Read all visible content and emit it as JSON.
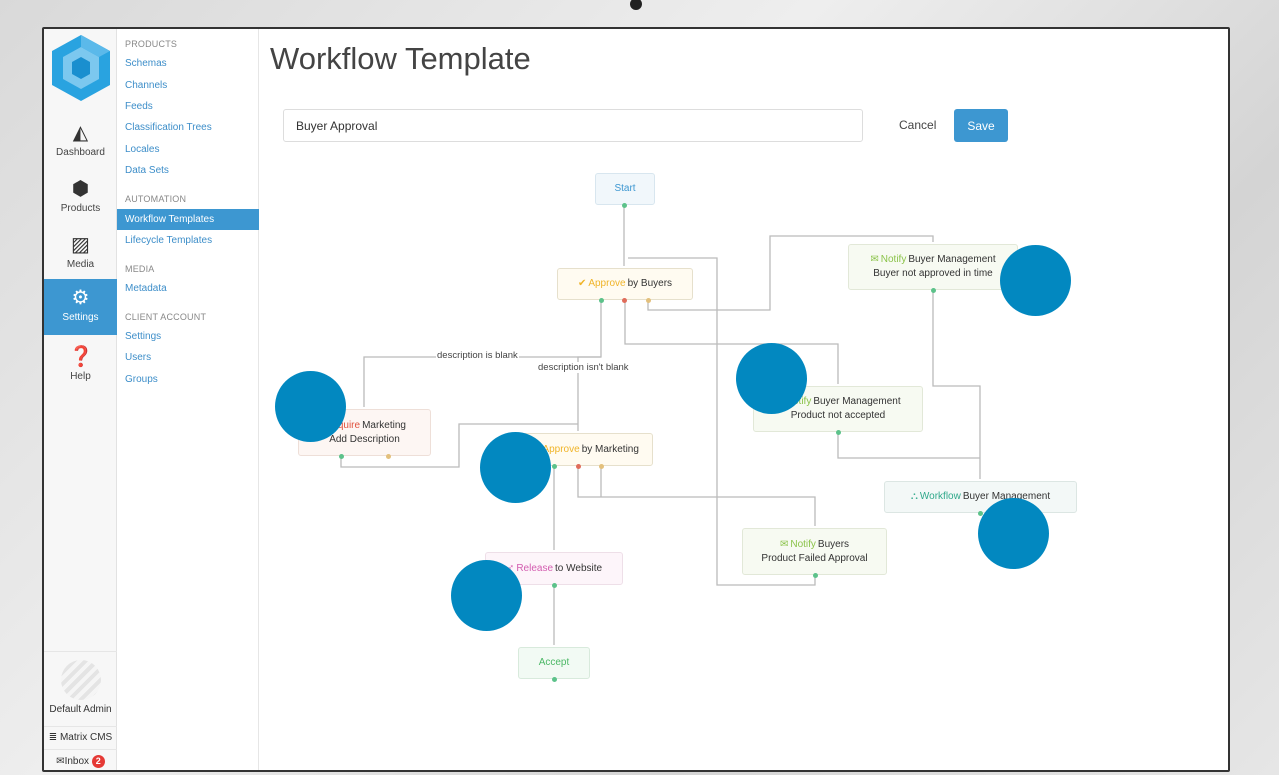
{
  "nav": {
    "items": [
      {
        "label": "Dashboard",
        "icon": "area-chart-icon"
      },
      {
        "label": "Products",
        "icon": "cube-icon"
      },
      {
        "label": "Media",
        "icon": "image-icon"
      },
      {
        "label": "Settings",
        "icon": "gear-icon",
        "active": true
      },
      {
        "label": "Help",
        "icon": "question-icon"
      }
    ],
    "user": "Default Admin",
    "tenant": "Matrix CMS",
    "inbox": "Inbox",
    "inbox_count": "2"
  },
  "submenu": {
    "sections": [
      {
        "title": "PRODUCTS",
        "links": [
          "Schemas",
          "Channels",
          "Feeds",
          "Classification Trees",
          "Locales",
          "Data Sets"
        ]
      },
      {
        "title": "AUTOMATION",
        "links": [
          "Workflow Templates",
          "Lifecycle Templates"
        ]
      },
      {
        "title": "MEDIA",
        "links": [
          "Metadata"
        ]
      },
      {
        "title": "CLIENT ACCOUNT",
        "links": [
          "Settings",
          "Users",
          "Groups"
        ]
      }
    ],
    "active": "Workflow Templates"
  },
  "page": {
    "title": "Workflow Template",
    "name_value": "Buyer Approval",
    "cancel": "Cancel",
    "save": "Save"
  },
  "colors": {
    "accent": "#3d97d1",
    "approve": "#f0b429",
    "notify": "#8bc34a",
    "require": "#e0523f",
    "release": "#d35db0",
    "workflow": "#2fa88a",
    "start": "#3d97d1",
    "accept": "#4cb866",
    "overlay": "#0288c0"
  },
  "workflow": {
    "start": "Start",
    "approve_buyers": {
      "kw": "Approve",
      "text": "by Buyers"
    },
    "notify_time": {
      "kw": "Notify",
      "text": "Buyer Management",
      "sub": "Buyer not approved in time"
    },
    "label_blank": "description is blank",
    "label_not_blank": "description isn't blank",
    "notify_not_accepted": {
      "kw": "Notify",
      "text": "Buyer Management",
      "sub": "Product not accepted"
    },
    "require_marketing": {
      "kw": "Require",
      "text": "Marketing",
      "sub": "Add Description"
    },
    "approve_marketing": {
      "kw": "Approve",
      "text": "by Marketing"
    },
    "workflow_bm": {
      "kw": "Workflow",
      "text": "Buyer Management"
    },
    "notify_buyers": {
      "kw": "Notify",
      "text": "Buyers",
      "sub": "Product Failed Approval"
    },
    "release": {
      "kw": "Release",
      "text": "to Website"
    },
    "accept": "Accept"
  }
}
